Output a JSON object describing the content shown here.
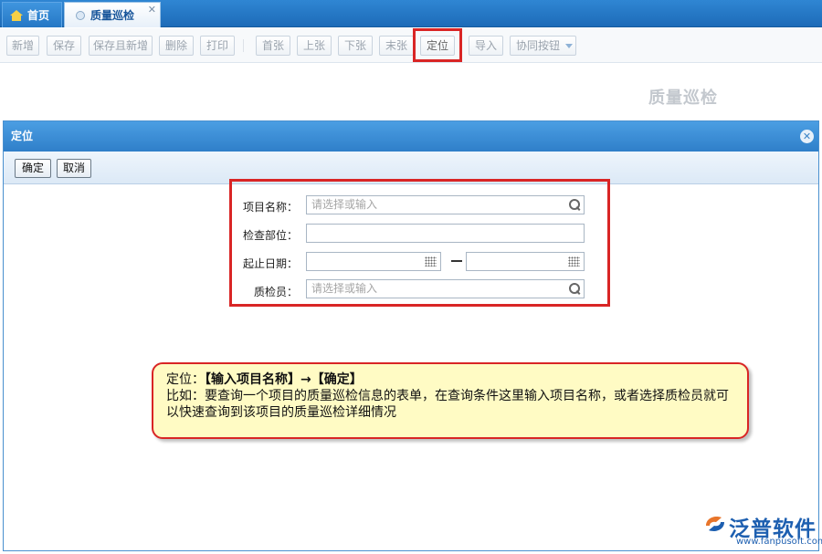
{
  "tabs": {
    "home_label": "首页",
    "active_label": "质量巡检",
    "close_glyph": "✕"
  },
  "toolbar": {
    "buttons": [
      "新增",
      "保存",
      "保存且新增",
      "删除",
      "打印",
      "首张",
      "上张",
      "下张",
      "末张",
      "定位",
      "导入",
      "协同按钮"
    ]
  },
  "page": {
    "bg_title": "质量巡检"
  },
  "dialog": {
    "title": "定位",
    "close_glyph": "✕",
    "confirm_label": "确定",
    "cancel_label": "取消",
    "fields": {
      "project_label": "项目名称：",
      "project_placeholder": "请选择或输入",
      "location_label": "检查部位：",
      "date_label": "起止日期：",
      "inspector_label": "质检员：",
      "inspector_placeholder": "请选择或输入"
    }
  },
  "callout": {
    "line1_prefix": "定位：",
    "line1_bold": "【输入项目名称】→【确定】",
    "line2": "比如：要查询一个项目的质量巡检信息的表单，在查询条件这里输入项目名称，或者选择质检员就可以快速查询到该项目的质量巡检详细情况"
  },
  "logo": {
    "name": "泛普软件",
    "url": "www.fanpusoft.com"
  },
  "colors": {
    "accent": "#2f7fc9",
    "highlight": "#d92525",
    "callout_bg": "#fffbc4"
  }
}
